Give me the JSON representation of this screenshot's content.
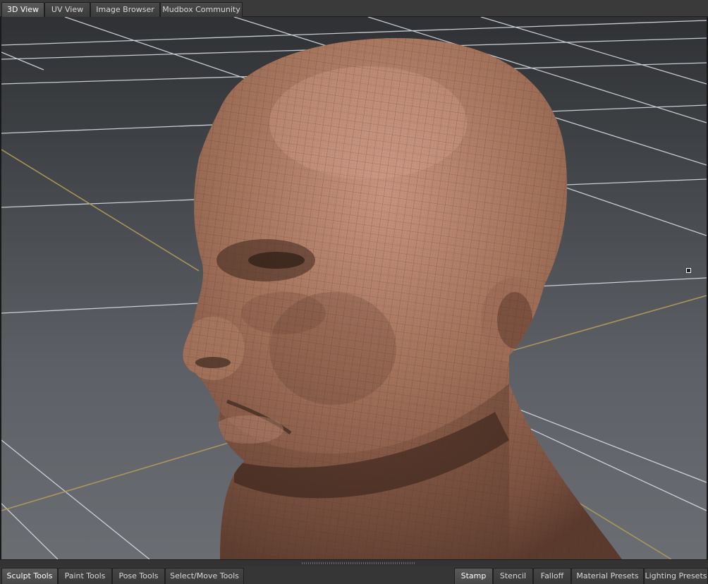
{
  "top_tabs": [
    {
      "label": "3D View",
      "active": true
    },
    {
      "label": "UV View",
      "active": false
    },
    {
      "label": "Image Browser",
      "active": false
    },
    {
      "label": "Mudbox Community",
      "active": false
    }
  ],
  "bottom_left_tabs": [
    {
      "label": "Sculpt Tools",
      "active": true
    },
    {
      "label": "Paint Tools",
      "active": false
    },
    {
      "label": "Pose Tools",
      "active": false
    },
    {
      "label": "Select/Move Tools",
      "active": false
    }
  ],
  "bottom_right_tabs": [
    {
      "label": "Stamp",
      "active": true
    },
    {
      "label": "Stencil",
      "active": false
    },
    {
      "label": "Falloff",
      "active": false
    },
    {
      "label": "Material Presets",
      "active": false
    },
    {
      "label": "Lighting Presets",
      "active": false
    }
  ],
  "viewport": {
    "subject": "sculpted-head-mesh",
    "skin_color": "#9a6a52",
    "grid_color": "#d8dde3",
    "axis_color": "#b39a5a"
  }
}
